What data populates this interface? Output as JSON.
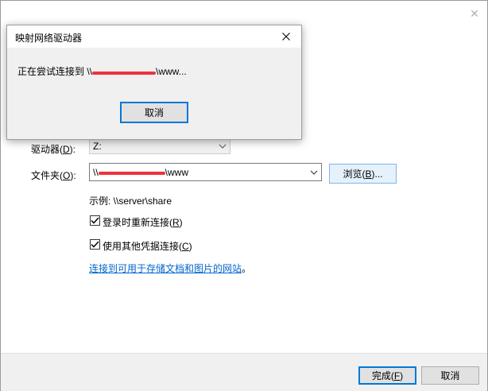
{
  "wizard": {
    "drive_label": "驱动器(",
    "drive_key": "D",
    "drive_suffix": "):",
    "drive_value": "Z:",
    "folder_label": "文件夹(",
    "folder_key": "O",
    "folder_suffix": "):",
    "folder_prefix": "\\\\",
    "folder_suffix_text": "\\www",
    "browse_label": "浏览(",
    "browse_key": "B",
    "browse_suffix": ")...",
    "example_text": "示例: \\\\server\\share",
    "reconnect_label": "登录时重新连接(",
    "reconnect_key": "R",
    "reconnect_suffix": ")",
    "reconnect_checked": true,
    "credentials_label": "使用其他凭据连接(",
    "credentials_key": "C",
    "credentials_suffix": ")",
    "credentials_checked": true,
    "link_text": "连接到可用于存储文档和图片的网站",
    "link_period": "。",
    "finish_label": "完成(",
    "finish_key": "F",
    "finish_suffix": ")",
    "cancel_label": "取消"
  },
  "modal": {
    "title": "映射网络驱动器",
    "message_prefix": "正在尝试连接到 \\\\",
    "message_suffix": "\\www...",
    "cancel_label": "取消"
  },
  "colors": {
    "accent": "#0078d7",
    "link": "#0066cc",
    "redaction": "#f0313e"
  }
}
